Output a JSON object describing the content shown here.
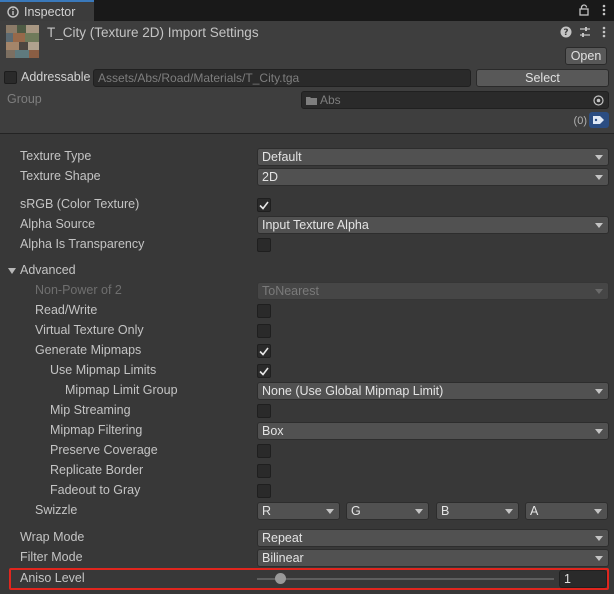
{
  "tab": {
    "label": "Inspector"
  },
  "header": {
    "title": "T_City (Texture 2D) Import Settings",
    "open_label": "Open",
    "addressable_label": "Addressable",
    "path": "Assets/Abs/Road/Materials/T_City.tga",
    "select_label": "Select",
    "group_label": "Group",
    "group_value": "Abs",
    "label_count": "(0)"
  },
  "props": {
    "texture_type": {
      "label": "Texture Type",
      "value": "Default"
    },
    "texture_shape": {
      "label": "Texture Shape",
      "value": "2D"
    },
    "srgb": {
      "label": "sRGB (Color Texture)",
      "checked": true
    },
    "alpha_source": {
      "label": "Alpha Source",
      "value": "Input Texture Alpha"
    },
    "alpha_transparency": {
      "label": "Alpha Is Transparency",
      "checked": false
    },
    "advanced": {
      "label": "Advanced"
    },
    "npot": {
      "label": "Non-Power of 2",
      "value": "ToNearest"
    },
    "read_write": {
      "label": "Read/Write",
      "checked": false
    },
    "virtual_texture": {
      "label": "Virtual Texture Only",
      "checked": false
    },
    "generate_mipmaps": {
      "label": "Generate Mipmaps",
      "checked": true
    },
    "use_mipmap_limits": {
      "label": "Use Mipmap Limits",
      "checked": true
    },
    "mipmap_limit_group": {
      "label": "Mipmap Limit Group",
      "value": "None (Use Global Mipmap Limit)"
    },
    "mip_streaming": {
      "label": "Mip Streaming",
      "checked": false
    },
    "mipmap_filtering": {
      "label": "Mipmap Filtering",
      "value": "Box"
    },
    "preserve_coverage": {
      "label": "Preserve Coverage",
      "checked": false
    },
    "replicate_border": {
      "label": "Replicate Border",
      "checked": false
    },
    "fadeout_gray": {
      "label": "Fadeout to Gray",
      "checked": false
    },
    "swizzle": {
      "label": "Swizzle",
      "values": [
        "R",
        "G",
        "B",
        "A"
      ]
    },
    "wrap_mode": {
      "label": "Wrap Mode",
      "value": "Repeat"
    },
    "filter_mode": {
      "label": "Filter Mode",
      "value": "Bilinear"
    },
    "aniso_level": {
      "label": "Aniso Level",
      "value": "1"
    }
  },
  "colors": {
    "accent": "#3a79bb",
    "highlight": "#e0261e",
    "panel": "#383838",
    "header": "#3e3e3e"
  },
  "icons": [
    "inspector-icon",
    "lock-icon",
    "menu-icon",
    "help-icon",
    "preset-icon",
    "more-icon",
    "folder-icon",
    "target-icon",
    "label-tag-icon",
    "checkmark-icon",
    "foldout-arrow-icon",
    "dropdown-arrow-icon"
  ]
}
